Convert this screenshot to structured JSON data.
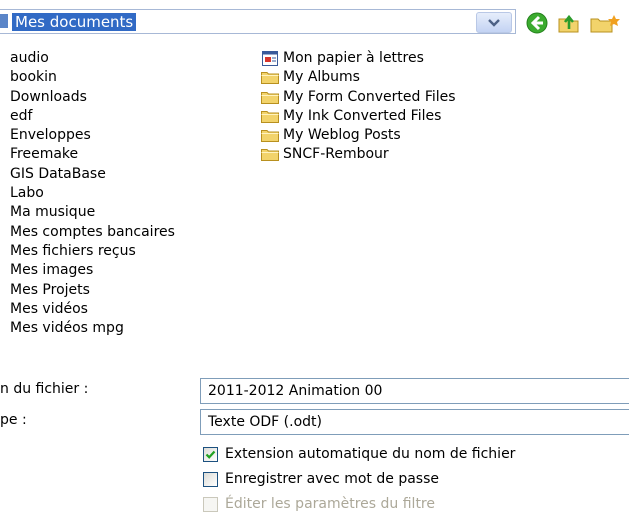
{
  "location": {
    "path": "Mes documents"
  },
  "folders_left": [
    "audio",
    "bookin",
    "Downloads",
    "edf",
    "Enveloppes",
    "Freemake",
    "GIS DataBase",
    "Labo",
    "Ma musique",
    "Mes comptes bancaires",
    "Mes fichiers reçus",
    "Mes images",
    "Mes Projets",
    "Mes vidéos",
    "Mes vidéos mpg"
  ],
  "items_right": [
    {
      "label": "Mon papier à lettres",
      "icon": "special-folder-icon"
    },
    {
      "label": "My Albums",
      "icon": "folder-icon"
    },
    {
      "label": "My Form Converted Files",
      "icon": "folder-icon"
    },
    {
      "label": "My Ink Converted Files",
      "icon": "folder-icon"
    },
    {
      "label": "My Weblog Posts",
      "icon": "folder-icon"
    },
    {
      "label": "SNCF-Rembour",
      "icon": "folder-icon"
    }
  ],
  "form": {
    "filename_label": "n du fichier :",
    "filename_value": "2011-2012 Animation 00",
    "type_label": "pe :",
    "type_value": "Texte ODF (.odt)",
    "options": [
      {
        "label": "Extension automatique du nom de fichier",
        "checked": true,
        "enabled": true
      },
      {
        "label": "Enregistrer avec mot de passe",
        "checked": false,
        "enabled": true
      },
      {
        "label": "Éditer les paramètres du filtre",
        "checked": false,
        "enabled": false
      }
    ]
  },
  "colors": {
    "selection": "#316ac5",
    "folder": "#f2d36b",
    "field_border": "#7f9db9"
  }
}
